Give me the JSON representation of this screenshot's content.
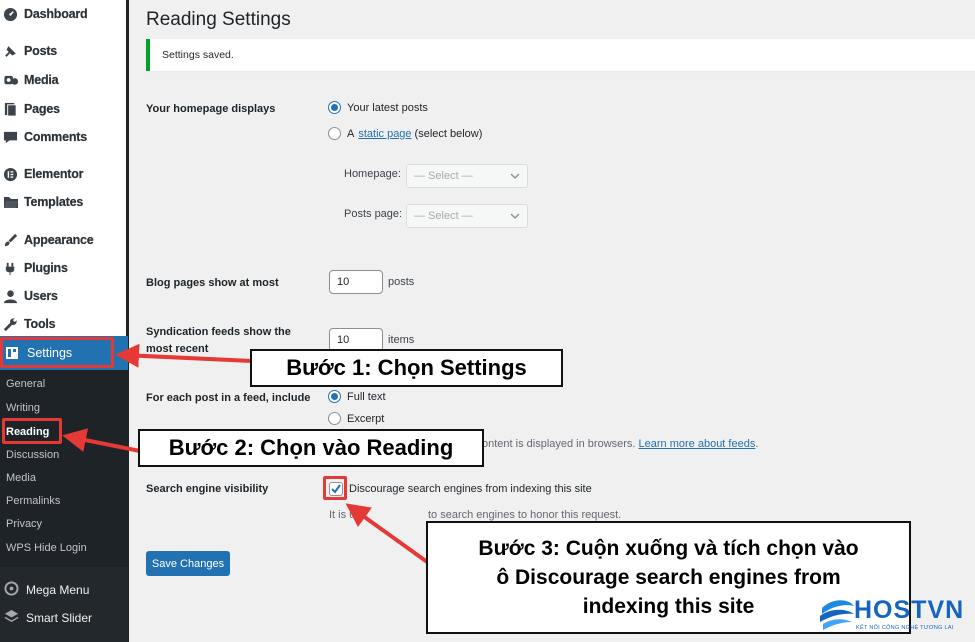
{
  "sidebar": {
    "items": [
      {
        "label": "Dashboard",
        "icon": "dashboard-icon"
      },
      {
        "label": "Posts",
        "icon": "pin-icon"
      },
      {
        "label": "Media",
        "icon": "media-icon"
      },
      {
        "label": "Pages",
        "icon": "pages-icon"
      },
      {
        "label": "Comments",
        "icon": "comments-icon"
      },
      {
        "label": "Elementor",
        "icon": "elementor-icon"
      },
      {
        "label": "Templates",
        "icon": "folder-icon"
      },
      {
        "label": "Appearance",
        "icon": "brush-icon"
      },
      {
        "label": "Plugins",
        "icon": "plug-icon"
      },
      {
        "label": "Users",
        "icon": "user-icon"
      },
      {
        "label": "Tools",
        "icon": "wrench-icon"
      }
    ],
    "settings_label": "Settings",
    "submenu": [
      "General",
      "Writing",
      "Reading",
      "Discussion",
      "Media",
      "Permalinks",
      "Privacy",
      "WPS Hide Login"
    ],
    "current_sub": "Reading",
    "extra": [
      {
        "label": "Mega Menu",
        "icon": "mega-menu-icon"
      },
      {
        "label": "Smart Slider",
        "icon": "slider-icon"
      }
    ]
  },
  "page": {
    "title": "Reading Settings",
    "notice": "Settings saved.",
    "homepage": {
      "label": "Your homepage displays",
      "option_latest": "Your latest posts",
      "option_static_prefix": "A",
      "option_static_link": "static page",
      "option_static_suffix": "(select below)",
      "selected": "latest",
      "homepage_label": "Homepage:",
      "posts_page_label": "Posts page:",
      "select_placeholder": "— Select —"
    },
    "blog_pages": {
      "label": "Blog pages show at most",
      "value": "10",
      "unit": "posts"
    },
    "syndication": {
      "label_line1": "Syndication feeds show the",
      "label_line2": "most recent",
      "value": "10",
      "unit": "items"
    },
    "feed_include": {
      "label": "For each post in a feed, include",
      "option_full": "Full text",
      "option_excerpt": "Excerpt",
      "selected": "full",
      "desc_visible": "ontent is displayed in browsers.",
      "desc_link": "Learn more about feeds"
    },
    "search_engine": {
      "label": "Search engine visibility",
      "checkbox_label": "Discourage search engines from indexing this site",
      "checked": true,
      "desc_start": "It is up",
      "desc_end": "to search engines to honor this request."
    },
    "save_button": "Save Changes"
  },
  "callouts": {
    "step1": "Bước 1: Chọn Settings",
    "step2": "Bước 2: Chọn vào Reading",
    "step3_line1": "Bước 3: Cuộn xuống và tích chọn vào",
    "step3_line2": "ô Discourage search engines from",
    "step3_line3": "indexing this site"
  },
  "logo": {
    "brand": "HOSTVN",
    "tagline": "KẾT NỐI CÔNG NGHỆ TƯƠNG LAI"
  },
  "colors": {
    "accent": "#2271b1",
    "notice": "#00a32a",
    "annotation_red": "#e53935",
    "sidebar_dark": "#1d2327"
  }
}
